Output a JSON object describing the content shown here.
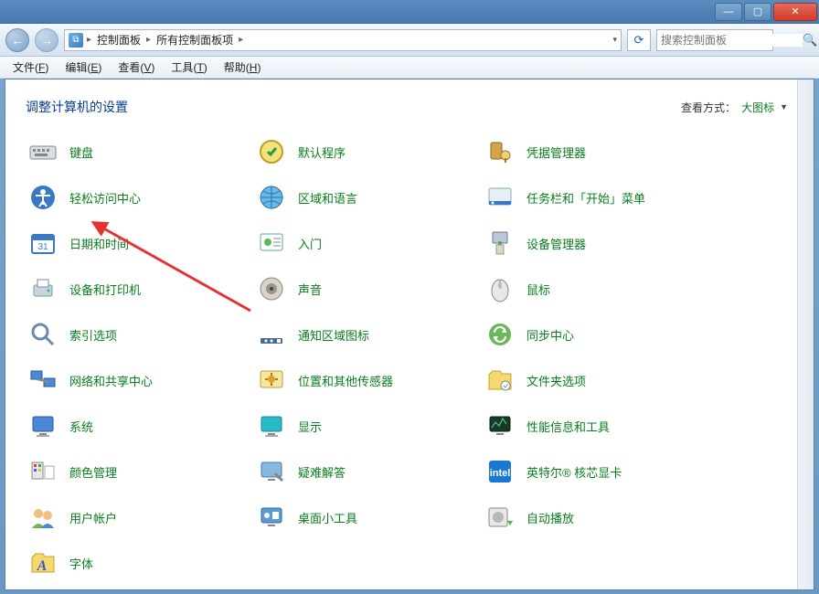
{
  "titlebar": {
    "min": "—",
    "max": "▢",
    "close": "✕"
  },
  "nav": {
    "back": "←",
    "forward": "→",
    "refresh": "⟳",
    "breadcrumb": {
      "root": "控制面板",
      "sub": "所有控制面板项"
    },
    "search_placeholder": "搜索控制面板"
  },
  "menubar": {
    "file": "文件",
    "file_u": "F",
    "edit": "编辑",
    "edit_u": "E",
    "view": "查看",
    "view_u": "V",
    "tools": "工具",
    "tools_u": "T",
    "help": "帮助",
    "help_u": "H"
  },
  "page": {
    "heading": "调整计算机的设置",
    "viewby_label": "查看方式：",
    "viewby_value": "大图标"
  },
  "items": [
    {
      "label": "键盘",
      "icon": "keyboard",
      "col": 0
    },
    {
      "label": "默认程序",
      "icon": "default-programs",
      "col": 1
    },
    {
      "label": "凭据管理器",
      "icon": "credential-manager",
      "col": 2
    },
    {
      "label": "轻松访问中心",
      "icon": "ease-of-access",
      "col": 0
    },
    {
      "label": "区域和语言",
      "icon": "region-language",
      "col": 1
    },
    {
      "label": "任务栏和「开始」菜单",
      "icon": "taskbar-start",
      "col": 2
    },
    {
      "label": "日期和时间",
      "icon": "date-time",
      "col": 0
    },
    {
      "label": "入门",
      "icon": "getting-started",
      "col": 1
    },
    {
      "label": "设备管理器",
      "icon": "device-manager",
      "col": 2
    },
    {
      "label": "设备和打印机",
      "icon": "devices-printers",
      "col": 0
    },
    {
      "label": "声音",
      "icon": "sound",
      "col": 1
    },
    {
      "label": "鼠标",
      "icon": "mouse",
      "col": 2
    },
    {
      "label": "索引选项",
      "icon": "indexing",
      "col": 0
    },
    {
      "label": "通知区域图标",
      "icon": "notification-icons",
      "col": 1
    },
    {
      "label": "同步中心",
      "icon": "sync-center",
      "col": 2
    },
    {
      "label": "网络和共享中心",
      "icon": "network-sharing",
      "col": 0
    },
    {
      "label": "位置和其他传感器",
      "icon": "location-sensors",
      "col": 1
    },
    {
      "label": "文件夹选项",
      "icon": "folder-options",
      "col": 2
    },
    {
      "label": "系统",
      "icon": "system",
      "col": 0
    },
    {
      "label": "显示",
      "icon": "display",
      "col": 1
    },
    {
      "label": "性能信息和工具",
      "icon": "performance",
      "col": 2
    },
    {
      "label": "颜色管理",
      "icon": "color-management",
      "col": 0
    },
    {
      "label": "疑难解答",
      "icon": "troubleshooting",
      "col": 1
    },
    {
      "label": "英特尔® 核芯显卡",
      "icon": "intel-graphics",
      "col": 2
    },
    {
      "label": "用户帐户",
      "icon": "user-accounts",
      "col": 0
    },
    {
      "label": "桌面小工具",
      "icon": "gadgets",
      "col": 1
    },
    {
      "label": "自动播放",
      "icon": "autoplay",
      "col": 2
    },
    {
      "label": "字体",
      "icon": "fonts",
      "col": 0
    }
  ]
}
